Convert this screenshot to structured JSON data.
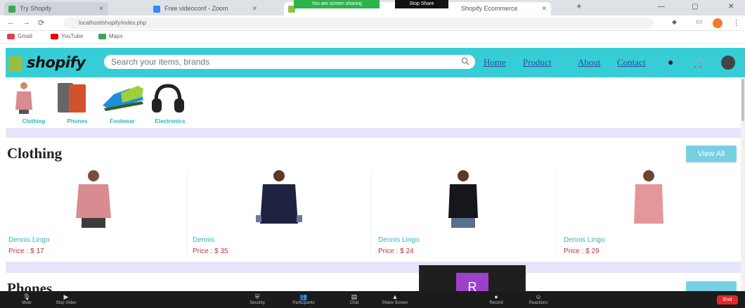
{
  "browser": {
    "tabs": [
      {
        "label": "Try Shopify",
        "active": false
      },
      {
        "label": "Free videoconf - Zoom",
        "active": false
      },
      {
        "label": "Shopify Ecommerce",
        "active": true
      }
    ],
    "share_banner": "You are screen sharing",
    "stop_share": "Stop Share",
    "url": "localhost/shopify/index.php",
    "bookmarks": [
      "Gmail",
      "YouTube",
      "Maps"
    ]
  },
  "site": {
    "logo": "shopify",
    "search_placeholder": "Search your items, brands",
    "nav_links": [
      "Home",
      "Product",
      "About",
      "Contact"
    ]
  },
  "categories": [
    {
      "label": "Clothing"
    },
    {
      "label": "Phones"
    },
    {
      "label": "Footwear"
    },
    {
      "label": "Electronics"
    }
  ],
  "clothing_section": {
    "title": "Clothing",
    "view_all": "View All",
    "products": [
      {
        "name": "Dennis Lingo",
        "price": "Price : $ 17",
        "shirt_color": "#d98b92"
      },
      {
        "name": "Dennis",
        "price": "Price : $ 35",
        "shirt_color": "#1d2340"
      },
      {
        "name": "Dennis Lingo",
        "price": "Price : $ 24",
        "shirt_color": "#16161c"
      },
      {
        "name": "Dennis Lingo",
        "price": "Price : $ 29",
        "shirt_color": "#e5969a"
      }
    ]
  },
  "phones_section": {
    "title": "Phones"
  },
  "zoom": {
    "participant_initial": "R",
    "toolbar": [
      "Mute",
      "Stop Video",
      "Security",
      "Participants",
      "Chat",
      "Share Screen",
      "Record",
      "Reactions"
    ],
    "end_label": "End"
  },
  "colors": {
    "navbar": "#36cdd6",
    "accent": "#2bb6bf",
    "price": "#c0333f",
    "strip": "#e6e6fa"
  }
}
